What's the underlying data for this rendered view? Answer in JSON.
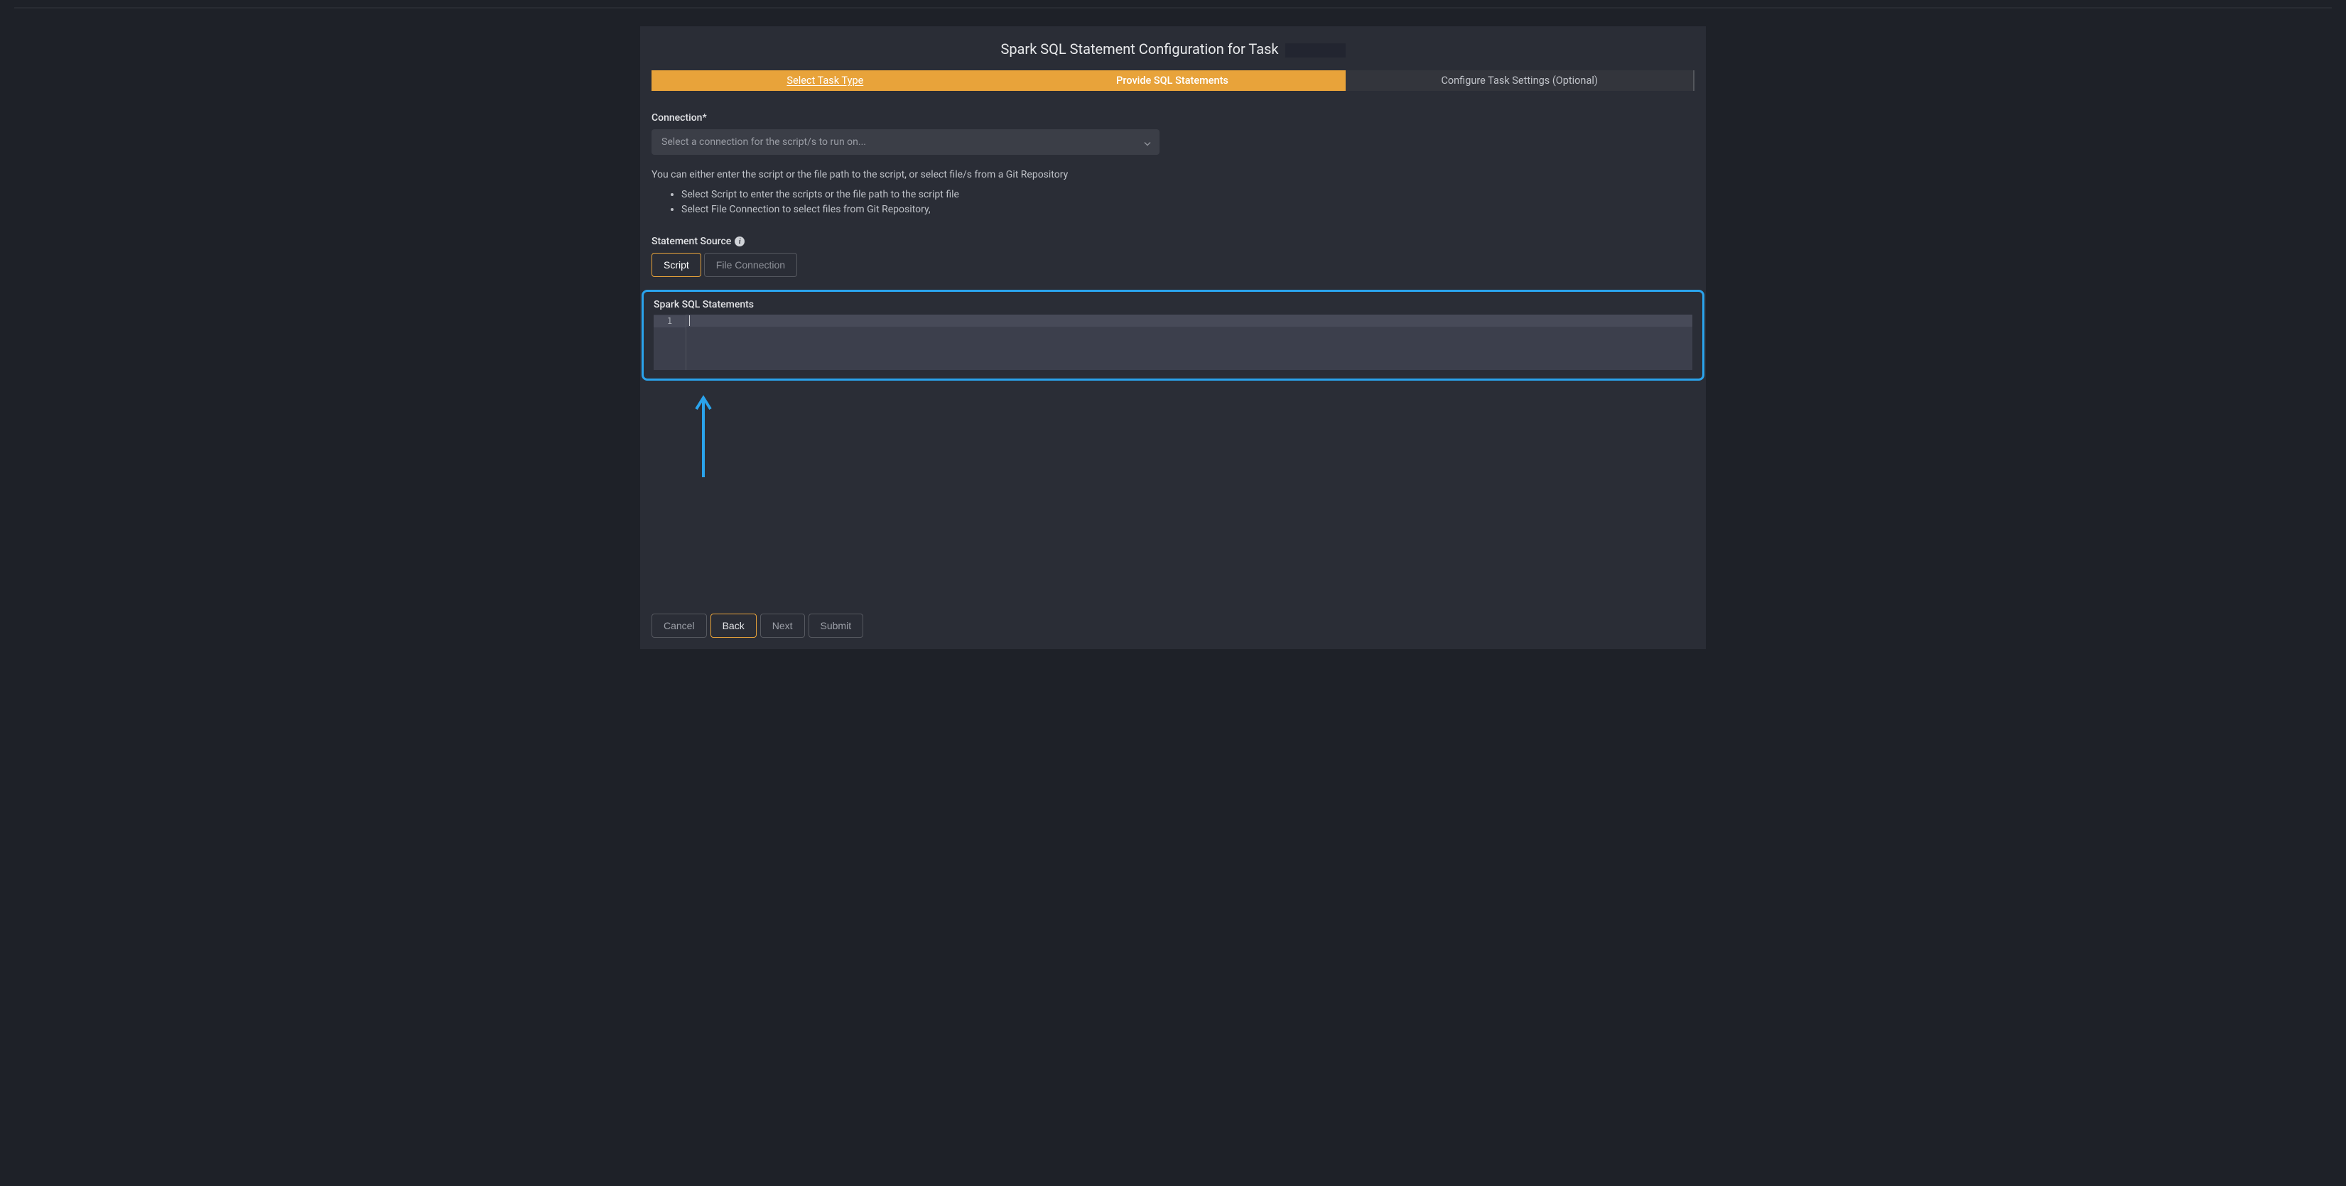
{
  "header": {
    "title_prefix": "Spark SQL Statement Configuration for Task"
  },
  "tabs": {
    "step1": "Select Task Type",
    "step2": "Provide SQL Statements",
    "step3": "Configure Task Settings (Optional)"
  },
  "form": {
    "connection_label": "Connection*",
    "connection_placeholder": "Select a connection for the script/s to run on...",
    "help_intro": "You can either enter the script or the file path to the script, or select file/s from a Git Repository",
    "help_item1": "Select Script to enter the scripts or the file path to the script file",
    "help_item2": "Select File Connection to select files from Git Repository,",
    "statement_source_label": "Statement Source",
    "toggle_script": "Script",
    "toggle_file_connection": "File Connection",
    "statements_label": "Spark SQL Statements",
    "editor_line_number": "1"
  },
  "footer": {
    "cancel": "Cancel",
    "back": "Back",
    "next": "Next",
    "submit": "Submit"
  },
  "annotation": {
    "arrow_color": "#2aa3ec"
  }
}
